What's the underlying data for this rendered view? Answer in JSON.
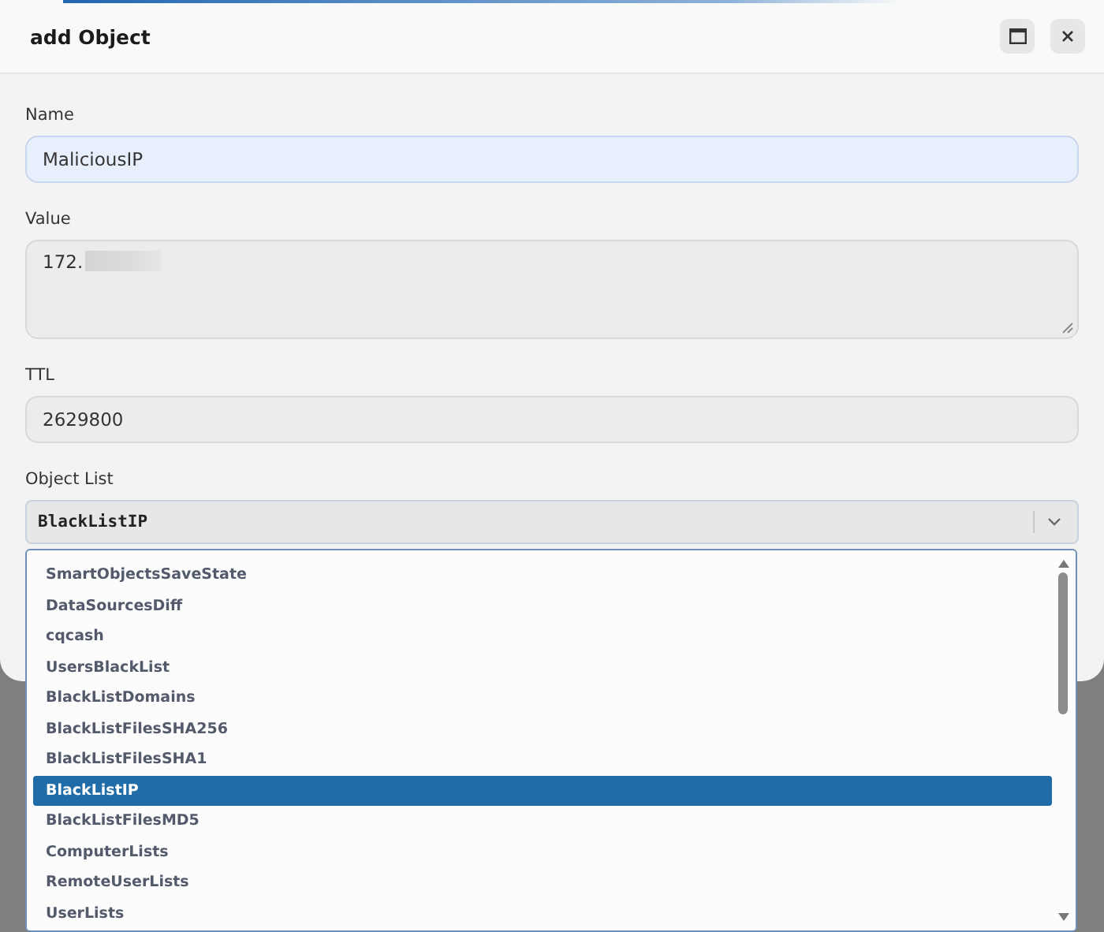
{
  "window": {
    "title": "add Object"
  },
  "fields": [
    {
      "label": "Name",
      "kind": "input",
      "value": "MaliciousIP",
      "focused": true
    },
    {
      "label": "Value",
      "kind": "textarea",
      "value": "172.",
      "redacted": true,
      "focused": false
    },
    {
      "label": "TTL",
      "kind": "input",
      "value": "2629800",
      "focused": false
    }
  ],
  "object_list": {
    "label": "Object List",
    "value": "BlackListIP",
    "expanded": true,
    "options": [
      {
        "label": "SmartObjectsSaveState",
        "selected": false
      },
      {
        "label": "DataSourcesDiff",
        "selected": false
      },
      {
        "label": "cqcash",
        "selected": false
      },
      {
        "label": "UsersBlackList",
        "selected": false
      },
      {
        "label": "BlackListDomains",
        "selected": false
      },
      {
        "label": "BlackListFilesSHA256",
        "selected": false
      },
      {
        "label": "BlackListFilesSHA1",
        "selected": false
      },
      {
        "label": "BlackListIP",
        "selected": true
      },
      {
        "label": "BlackListFilesMD5",
        "selected": false
      },
      {
        "label": "ComputerLists",
        "selected": false
      },
      {
        "label": "RemoteUserLists",
        "selected": false
      },
      {
        "label": "UserLists",
        "selected": false
      }
    ]
  }
}
